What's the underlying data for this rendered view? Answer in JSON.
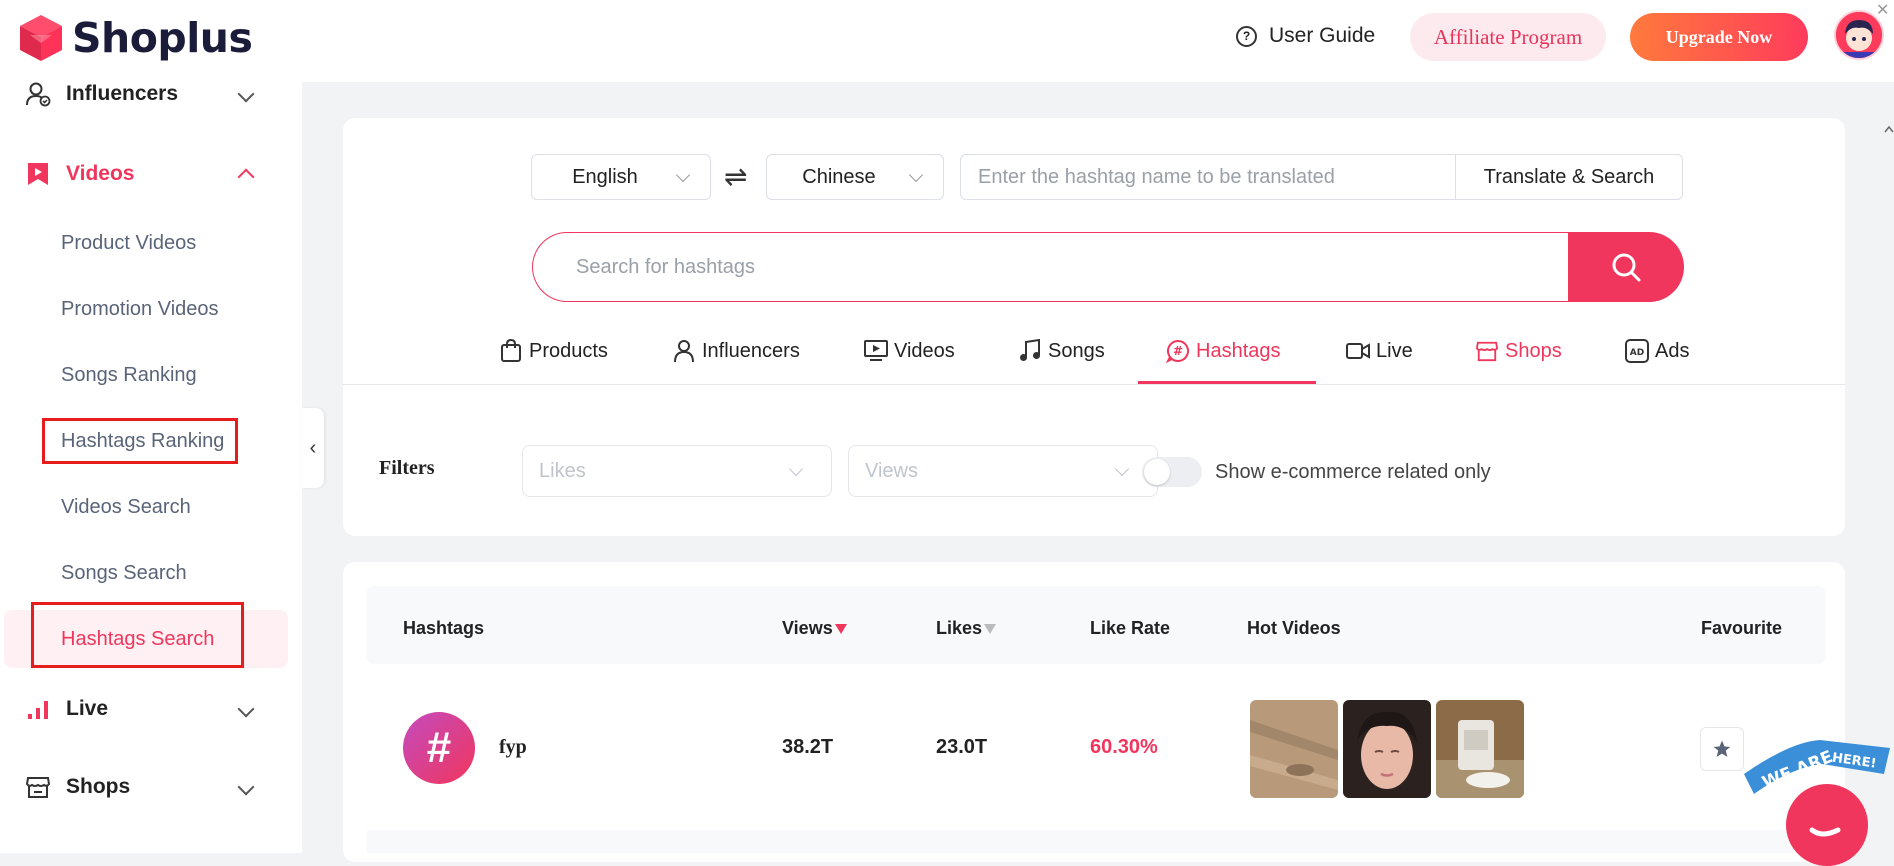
{
  "header": {
    "brand": "Shoplus",
    "user_guide": "User Guide",
    "affiliate": "Affiliate Program",
    "upgrade": "Upgrade Now"
  },
  "sidebar": {
    "groups": {
      "influencers": "Influencers",
      "videos": "Videos",
      "live": "Live",
      "shops": "Shops"
    },
    "video_items": [
      "Product Videos",
      "Promotion Videos",
      "Songs Ranking",
      "Hashtags Ranking",
      "Videos Search",
      "Songs Search",
      "Hashtags Search"
    ],
    "selected": "Hashtags Search"
  },
  "translate": {
    "from_lang": "English",
    "to_lang": "Chinese",
    "placeholder": "Enter the hashtag name to be translated",
    "button": "Translate & Search"
  },
  "search": {
    "placeholder": "Search for hashtags"
  },
  "tabs": [
    "Products",
    "Influencers",
    "Videos",
    "Songs",
    "Hashtags",
    "Live",
    "Shops",
    "Ads"
  ],
  "active_tab": "Hashtags",
  "filters": {
    "label": "Filters",
    "likes_placeholder": "Likes",
    "views_placeholder": "Views",
    "ecommerce_toggle": "Show e-commerce related only",
    "ecommerce_on": false
  },
  "table": {
    "headers": {
      "hashtags": "Hashtags",
      "views": "Views",
      "likes": "Likes",
      "like_rate": "Like Rate",
      "hot_videos": "Hot Videos",
      "favourite": "Favourite"
    },
    "rows": [
      {
        "icon": "#",
        "name": "fyp",
        "views": "38.2T",
        "likes": "23.0T",
        "like_rate": "60.30%"
      }
    ]
  },
  "widget": {
    "we_are": "WE ARE",
    "here": "HERE!"
  },
  "colors": {
    "accent": "#f0365c",
    "highlight_box": "#e51d1d"
  }
}
